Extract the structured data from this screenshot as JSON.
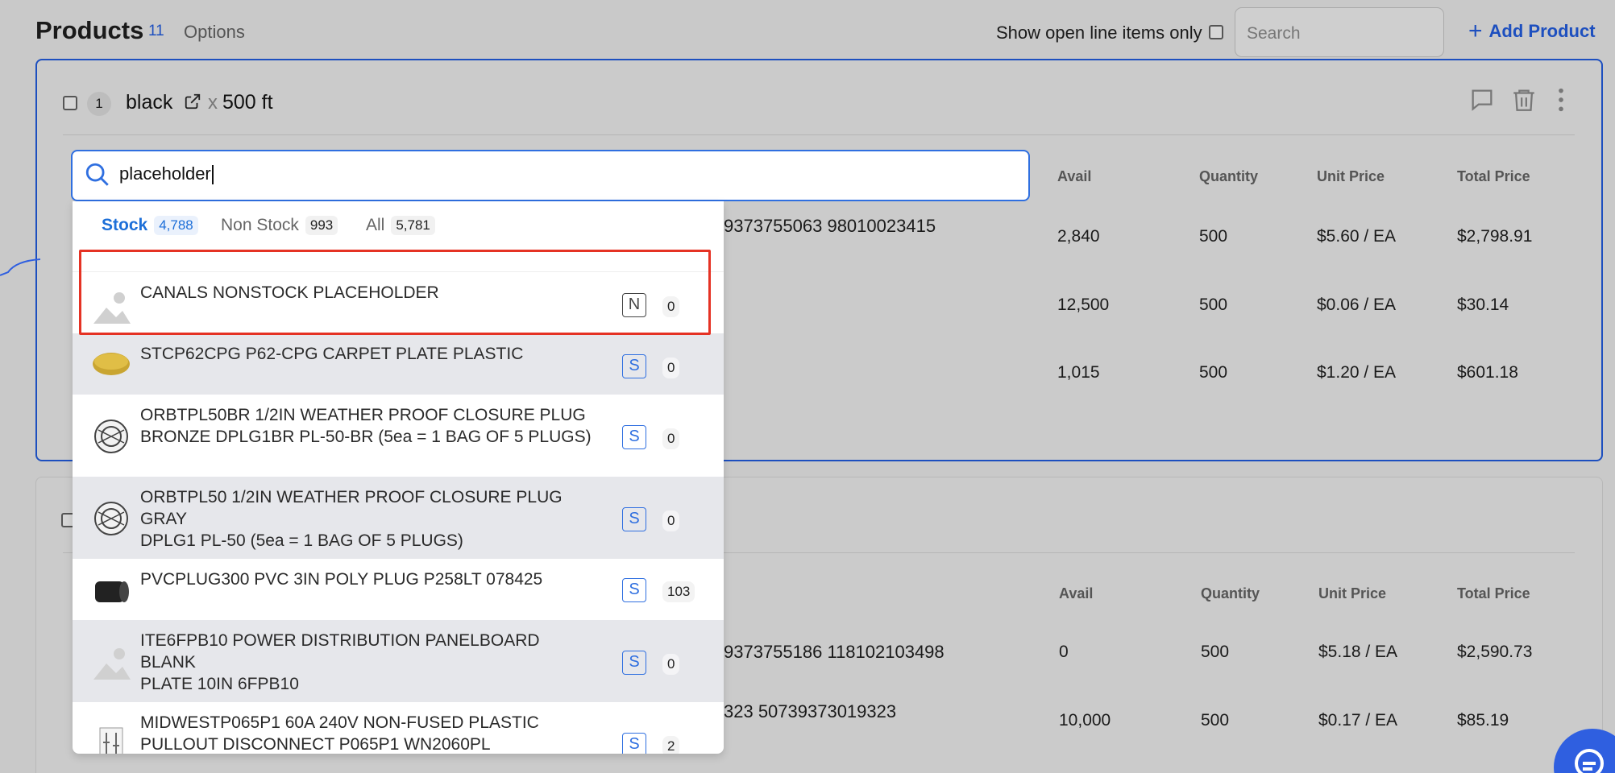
{
  "header": {
    "title": "Products",
    "count": "11",
    "options_label": "Options",
    "open_only_label": "Show open line items only",
    "search_placeholder": "Search",
    "add_product_label": "Add Product"
  },
  "card1": {
    "line_number": "1",
    "name": "black",
    "times": "x",
    "quantity_label": "500 ft",
    "columns": [
      "Avail",
      "Quantity",
      "Unit Price",
      "Total Price"
    ],
    "partial_upc": "9373755063 98010023415",
    "rows": [
      {
        "avail": "2,840",
        "quantity": "500",
        "unit_price": "$5.60 / EA",
        "total": "$2,798.91"
      },
      {
        "avail": "12,500",
        "quantity": "500",
        "unit_price": "$0.06 / EA",
        "total": "$30.14"
      },
      {
        "avail": "1,015",
        "quantity": "500",
        "unit_price": "$1.20 / EA",
        "total": "$601.18"
      }
    ]
  },
  "card2": {
    "columns": [
      "Avail",
      "Quantity",
      "Unit Price",
      "Total Price"
    ],
    "partial_upc_1": "9373755186 118102103498",
    "partial_upc_2": "323 50739373019323",
    "rows": [
      {
        "avail": "0",
        "quantity": "500",
        "unit_price": "$5.18 / EA",
        "total": "$2,590.73"
      },
      {
        "avail": "10,000",
        "quantity": "500",
        "unit_price": "$0.17 / EA",
        "total": "$85.19"
      }
    ]
  },
  "picker": {
    "query": "placeholder",
    "tabs": [
      {
        "label": "Stock",
        "count": "4,788"
      },
      {
        "label": "Non Stock",
        "count": "993"
      },
      {
        "label": "All",
        "count": "5,781"
      }
    ],
    "items": [
      {
        "line1": "CANALS NONSTOCK PLACEHOLDER",
        "line2": "",
        "type": "N",
        "avail": "0",
        "thumb": "placeholder-image-icon"
      },
      {
        "line1": "STCP62CPG P62-CPG CARPET PLATE PLASTIC",
        "line2": "",
        "type": "S",
        "avail": "0",
        "thumb": "carpet-plate-thumb"
      },
      {
        "line1": "ORBTPL50BR 1/2IN WEATHER PROOF CLOSURE PLUG",
        "line2": "BRONZE DPLG1BR PL-50-BR (5ea = 1 BAG OF 5 PLUGS)",
        "type": "S",
        "avail": "0",
        "thumb": "closure-plug-thumb"
      },
      {
        "line1": "ORBTPL50 1/2IN WEATHER PROOF CLOSURE PLUG GRAY",
        "line2": "DPLG1 PL-50 (5ea = 1 BAG OF 5 PLUGS)",
        "type": "S",
        "avail": "0",
        "thumb": "closure-plug-thumb"
      },
      {
        "line1": "PVCPLUG300 PVC 3IN POLY PLUG P258LT 078425",
        "line2": "",
        "type": "S",
        "avail": "103",
        "thumb": "poly-plug-thumb"
      },
      {
        "line1": "ITE6FPB10 POWER DISTRIBUTION PANELBOARD BLANK",
        "line2": "PLATE 10IN 6FPB10",
        "type": "S",
        "avail": "0",
        "thumb": "placeholder-image-icon"
      },
      {
        "line1": "MIDWESTP065P1 60A 240V NON-FUSED PLASTIC",
        "line2": "PULLOUT DISCONNECT P065P1 WN2060PL",
        "type": "S",
        "avail": "2",
        "thumb": "disconnect-thumb"
      }
    ]
  },
  "colors": {
    "accent": "#1d4fbf",
    "focus": "#2f6fe0",
    "highlight": "#e53224",
    "overlay_bg": "#c9c9c9"
  }
}
